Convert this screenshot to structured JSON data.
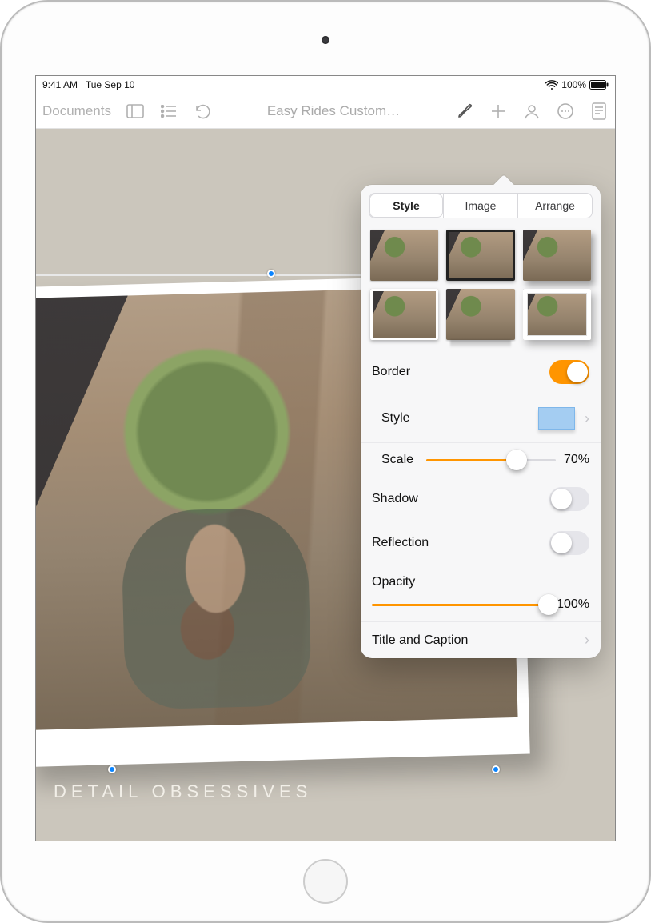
{
  "statusbar": {
    "time": "9:41 AM",
    "date": "Tue Sep 10",
    "battery": "100%"
  },
  "toolbar": {
    "back_label": "Documents",
    "title": "Easy Rides Custom…"
  },
  "canvas": {
    "caption": "DETAIL OBSESSIVES"
  },
  "popover": {
    "tabs": {
      "style": "Style",
      "image": "Image",
      "arrange": "Arrange",
      "selected": "style"
    },
    "border": {
      "label": "Border",
      "on": true,
      "style_label": "Style",
      "scale_label": "Scale",
      "scale_value": 70,
      "scale_display": "70%"
    },
    "shadow": {
      "label": "Shadow",
      "on": false
    },
    "reflection": {
      "label": "Reflection",
      "on": false
    },
    "opacity": {
      "label": "Opacity",
      "value": 100,
      "display": "100%"
    },
    "title_caption": {
      "label": "Title and Caption"
    }
  }
}
